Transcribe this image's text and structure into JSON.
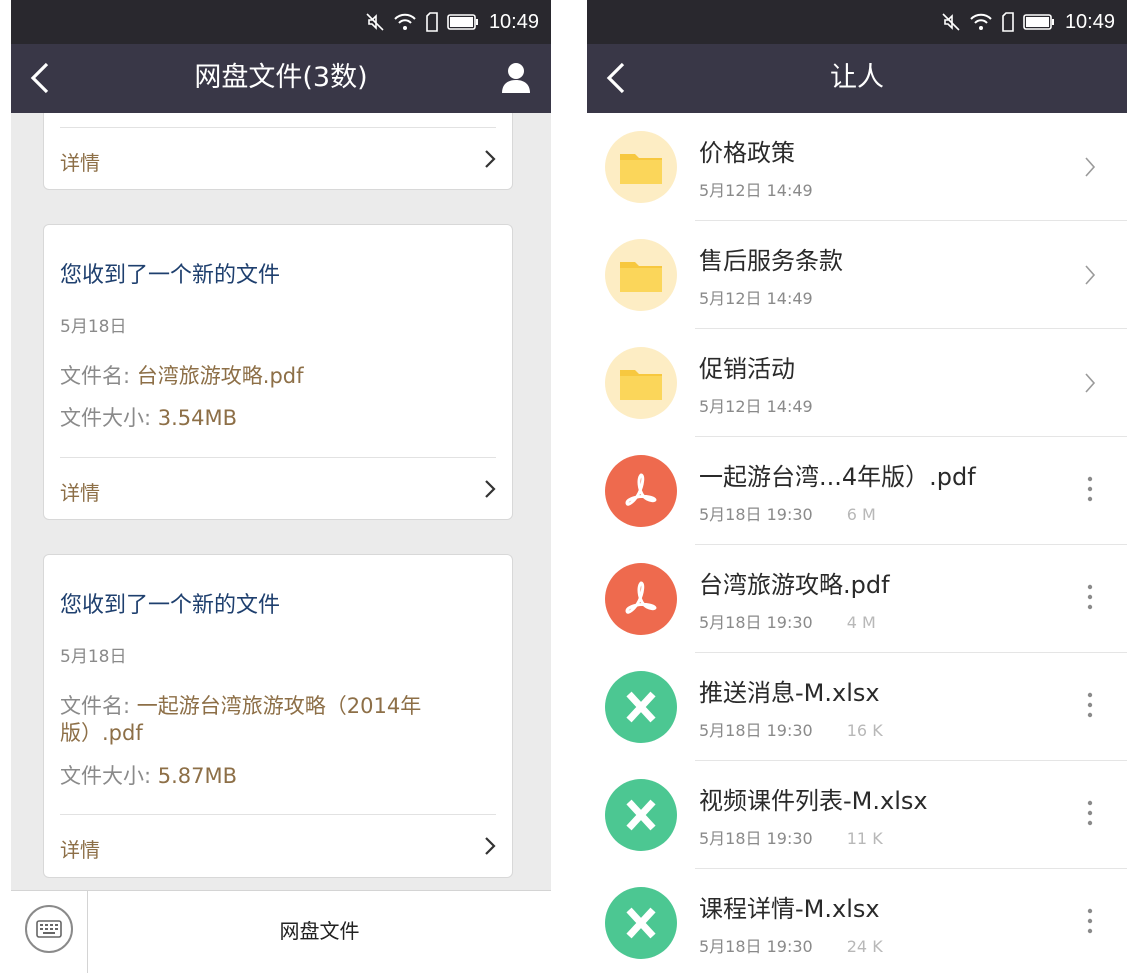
{
  "status_time": "10:49",
  "colors": {
    "nav_bg": "#393747",
    "status_bg": "#29282e",
    "link": "#1e3f6e",
    "accent_brown": "#8d6f47",
    "folder_bg": "#fdedc4",
    "folder": "#f7c83f",
    "pdf": "#ee6a4e",
    "xlsx": "#4cc792"
  },
  "left": {
    "title": "网盘文件(3数)",
    "partial_card": {
      "detail_label": "详情"
    },
    "cards": [
      {
        "title": "您收到了一个新的文件",
        "date": "5月18日",
        "name_label": "文件名: ",
        "name_value": "台湾旅游攻略.pdf",
        "size_label": "文件大小: ",
        "size_value": "3.54MB",
        "detail_label": "详情"
      },
      {
        "title": "您收到了一个新的文件",
        "date": "5月18日",
        "name_label": "文件名: ",
        "name_value": "一起游台湾旅游攻略（2014年版）.pdf",
        "size_label": "文件大小: ",
        "size_value": "5.87MB",
        "detail_label": "详情"
      }
    ],
    "bottom_label": "网盘文件"
  },
  "right": {
    "title": "让人",
    "items": [
      {
        "type": "folder",
        "icon": "folder-icon",
        "name": "价格政策",
        "date": "5月12日 14:49",
        "size": ""
      },
      {
        "type": "folder",
        "icon": "folder-icon",
        "name": "售后服务条款",
        "date": "5月12日 14:49",
        "size": ""
      },
      {
        "type": "folder",
        "icon": "folder-icon",
        "name": "促销活动",
        "date": "5月12日 14:49",
        "size": ""
      },
      {
        "type": "pdf",
        "icon": "pdf-icon",
        "name": "一起游台湾...4年版）.pdf",
        "date": "5月18日 19:30",
        "size": "6 M"
      },
      {
        "type": "pdf",
        "icon": "pdf-icon",
        "name": "台湾旅游攻略.pdf",
        "date": "5月18日 19:30",
        "size": "4 M"
      },
      {
        "type": "xlsx",
        "icon": "excel-icon",
        "name": "推送消息-M.xlsx",
        "date": "5月18日 19:30",
        "size": "16 K"
      },
      {
        "type": "xlsx",
        "icon": "excel-icon",
        "name": "视频课件列表-M.xlsx",
        "date": "5月18日 19:30",
        "size": "11 K"
      },
      {
        "type": "xlsx",
        "icon": "excel-icon",
        "name": "课程详情-M.xlsx",
        "date": "5月18日 19:30",
        "size": "24 K"
      }
    ]
  }
}
